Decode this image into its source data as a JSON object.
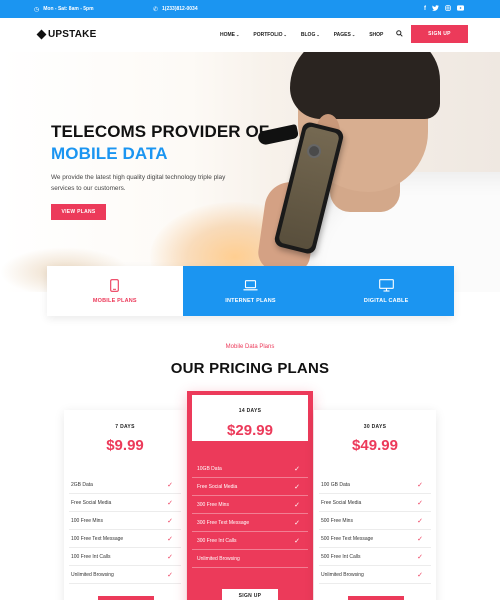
{
  "topbar": {
    "hours": "Mon - Sat: 8am - 5pm",
    "phone": "1(233)812-0034",
    "socials": [
      "facebook",
      "twitter",
      "instagram",
      "youtube"
    ]
  },
  "nav": {
    "logo": "UPSTAKE",
    "items": [
      {
        "label": "HOME",
        "dropdown": true
      },
      {
        "label": "PORTFOLIO",
        "dropdown": true
      },
      {
        "label": "BLOG",
        "dropdown": true
      },
      {
        "label": "PAGES",
        "dropdown": true
      },
      {
        "label": "SHOP",
        "dropdown": false
      }
    ],
    "signup": "SIGN UP"
  },
  "hero": {
    "title_line1": "TELECOMS PROVIDER OF",
    "title_line2": "MOBILE DATA",
    "description": "We provide the latest high quality digital technology triple play services to our customers.",
    "button": "VIEW PLANS"
  },
  "tabs": [
    {
      "label": "MOBILE PLANS",
      "icon": "mobile-icon",
      "active": true
    },
    {
      "label": "INTERNET PLANS",
      "icon": "laptop-icon",
      "active": false
    },
    {
      "label": "DIGITAL CABLE",
      "icon": "monitor-icon",
      "active": false
    }
  ],
  "pricing": {
    "tag": "Mobile Data Plans",
    "title": "OUR PRICING PLANS",
    "plans": [
      {
        "days": "7 DAYS",
        "price": "$9.99",
        "features": [
          "2GB Data",
          "Free Social Media",
          "100 Free Mins",
          "100 Free Text Message",
          "100 Free Int Calls",
          "Unlimited Browsing"
        ],
        "checks": [
          true,
          true,
          true,
          true,
          true,
          true
        ]
      },
      {
        "days": "14 DAYS",
        "price": "$29.99",
        "features": [
          "10GB Data",
          "Free Social Media",
          "300 Free Mins",
          "300 Free Text Message",
          "300 Free Int Calls",
          "Unlimited Browsing"
        ],
        "checks": [
          true,
          true,
          true,
          true,
          true,
          false
        ],
        "button": "SIGN UP"
      },
      {
        "days": "30 DAYS",
        "price": "$49.99",
        "features": [
          "100 GB Data",
          "Free Social Media",
          "500 Free Mins",
          "500 Free Text Message",
          "500 Free Int Calls",
          "Unlimited Browsing"
        ],
        "checks": [
          true,
          true,
          true,
          true,
          true,
          true
        ]
      }
    ]
  },
  "colors": {
    "blue": "#1b95f1",
    "red": "#ec3a5a"
  }
}
